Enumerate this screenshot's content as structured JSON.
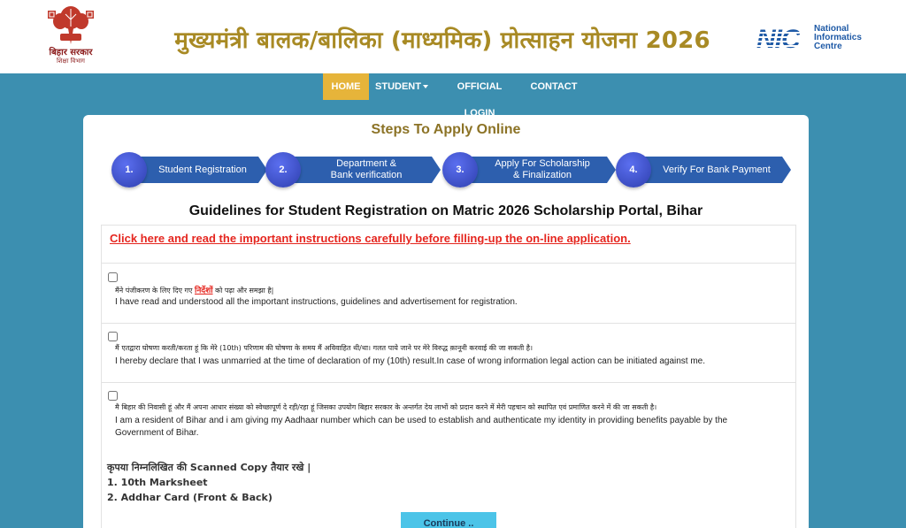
{
  "header": {
    "logo_line1": "बिहार सरकार",
    "logo_line2": "शिक्षा विभाग",
    "title": "मुख्यमंत्री बालक/बालिका (माध्यमिक) प्रोत्साहन योजना 2026",
    "nic_mark": "NIC",
    "nic_line1": "National",
    "nic_line2": "Informatics",
    "nic_line3": "Centre"
  },
  "nav": {
    "home": "HOME",
    "student": "STUDENT",
    "login": "OFFICIAL LOGIN",
    "contact": "CONTACT"
  },
  "steps": {
    "title": "Steps To Apply Online",
    "items": [
      {
        "num": "1.",
        "line1": "Student Registration",
        "line2": ""
      },
      {
        "num": "2.",
        "line1": "Department &",
        "line2": "Bank verification"
      },
      {
        "num": "3.",
        "line1": "Apply For Scholarship",
        "line2": "& Finalization"
      },
      {
        "num": "4.",
        "line1": "Verify For Bank Payment",
        "line2": ""
      }
    ]
  },
  "guidelines": {
    "title": "Guidelines for Student Registration on Matric 2026 Scholarship Portal, Bihar",
    "link": "Click here and read the important instructions carefully before filling-up the on-line application."
  },
  "declarations": [
    {
      "hindi_pre": "मैंने पंजीकरण के लिए दिए गए ",
      "hindi_link": "निर्देशों",
      "hindi_post": " को पढ़ा और समझा है|",
      "english": "I have read and understood all the important instructions, guidelines and advertisement for registration."
    },
    {
      "hindi": "मैं एतद्वारा घोषणा करती/करता हूं कि मेरे (10th) परिणाम की घोषणा के समय मैं अविवाहित थी/था। गलत पाये जाने पर मेरे विरुद्ध क़ानूनी करवाई की जा सकती है।",
      "english": "I hereby declare that I was unmarried at the time of declaration of my (10th) result.In case of wrong information legal action can be initiated against me."
    },
    {
      "hindi": "मै बिहार की निवासी हूं और मैं अपना आधार संख्या को स्वेच्छापूर्ण दे रही/रहा हूं जिसका उपयोग बिहार सरकार के अन्तर्गत देय लाभों को प्रदान करने में मेरी पहचान को स्थापित एवं प्रमाणित करने में की जा सकती है।",
      "english": "I am a resident of Bihar and i am giving my Aadhaar number which can be used to establish and authenticate my identity in providing benefits payable by the Government of Bihar."
    }
  ],
  "documents": {
    "heading": "कृपया निम्नलिखित की Scanned Copy तैयार रखे |",
    "item1": "1. 10th Marksheet",
    "item2": "2. Addhar Card (Front & Back)"
  },
  "continue_label": "Continue ..",
  "colors": {
    "background": "#3c8fb0",
    "nav_active": "#e6b43a",
    "title_gold": "#a88a24",
    "step_blue": "#2d5fae",
    "link_red": "#e5261f",
    "button": "#4cc4e8"
  }
}
